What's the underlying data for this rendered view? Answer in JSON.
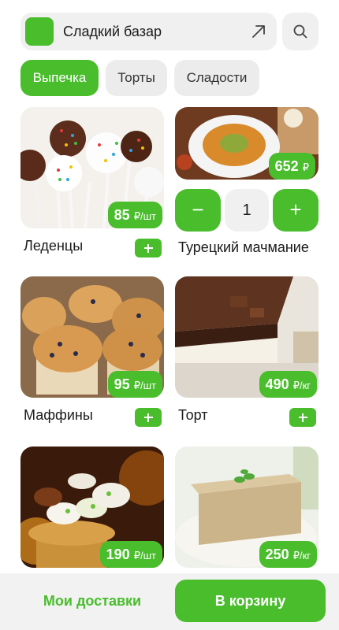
{
  "header": {
    "shop_name": "Сладкий базар",
    "share_icon": "share-arrow-icon",
    "search_icon": "search-icon"
  },
  "tabs": [
    {
      "label": "Выпечка",
      "active": true
    },
    {
      "label": "Торты",
      "active": false
    },
    {
      "label": "Сладости",
      "active": false
    }
  ],
  "products": [
    {
      "name": "Леденцы",
      "price": "85",
      "unit": "₽/шт"
    },
    {
      "name": "Турецкий мачмание",
      "price": "652",
      "unit": "₽",
      "quantity": "1",
      "minus_label": "−",
      "plus_label": "+"
    },
    {
      "name": "Маффины",
      "price": "95",
      "unit": "₽/шт"
    },
    {
      "name": "Торт",
      "price": "490",
      "unit": "₽/кг"
    },
    {
      "name": "",
      "price": "190",
      "unit": "₽/шт"
    },
    {
      "name": "",
      "price": "250",
      "unit": "₽/кг"
    }
  ],
  "bottom": {
    "deliveries_label": "Мои доставки",
    "cart_label": "В корзину"
  },
  "colors": {
    "accent": "#49bd2c",
    "chip_bg": "#ececec"
  }
}
